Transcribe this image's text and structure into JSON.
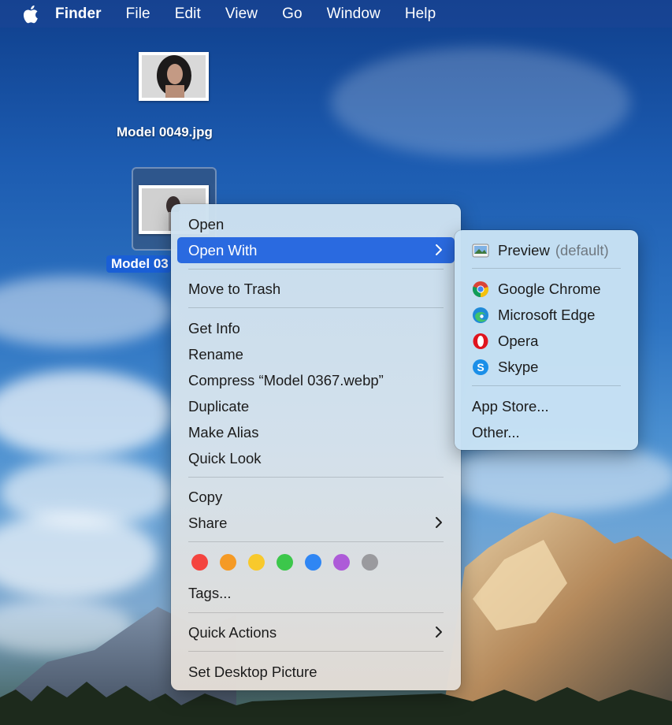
{
  "menubar": {
    "app_name": "Finder",
    "items": [
      "File",
      "Edit",
      "View",
      "Go",
      "Window",
      "Help"
    ]
  },
  "desktop": {
    "icons": [
      {
        "label": "Model 0049.jpg",
        "selected": false
      },
      {
        "label": "Model 0367.webp",
        "selected": true,
        "visible_label": "Model 03"
      }
    ]
  },
  "context_menu": {
    "items": {
      "open": "Open",
      "open_with": "Open With",
      "move_to_trash": "Move to Trash",
      "get_info": "Get Info",
      "rename": "Rename",
      "compress": "Compress “Model 0367.webp”",
      "duplicate": "Duplicate",
      "make_alias": "Make Alias",
      "quick_look": "Quick Look",
      "copy": "Copy",
      "share": "Share",
      "tags": "Tags...",
      "quick_actions": "Quick Actions",
      "set_desktop_picture": "Set Desktop Picture"
    },
    "highlighted": "Open With",
    "tag_colors": [
      {
        "name": "red",
        "color": "#f4443f"
      },
      {
        "name": "orange",
        "color": "#f59a25"
      },
      {
        "name": "yellow",
        "color": "#f8c92c"
      },
      {
        "name": "green",
        "color": "#3cc74b"
      },
      {
        "name": "blue",
        "color": "#2f86f4"
      },
      {
        "name": "purple",
        "color": "#ad5bd8"
      },
      {
        "name": "gray",
        "color": "#9a9a9e"
      }
    ]
  },
  "open_with_submenu": {
    "default_app": "Preview",
    "default_suffix": "(default)",
    "apps": [
      {
        "name": "Google Chrome",
        "icon": "chrome-icon"
      },
      {
        "name": "Microsoft Edge",
        "icon": "edge-icon"
      },
      {
        "name": "Opera",
        "icon": "opera-icon"
      },
      {
        "name": "Skype",
        "icon": "skype-icon"
      }
    ],
    "app_store": "App Store...",
    "other": "Other..."
  },
  "colors": {
    "highlight": "#2a6ae0",
    "selection_label": "#1a5fd6"
  }
}
